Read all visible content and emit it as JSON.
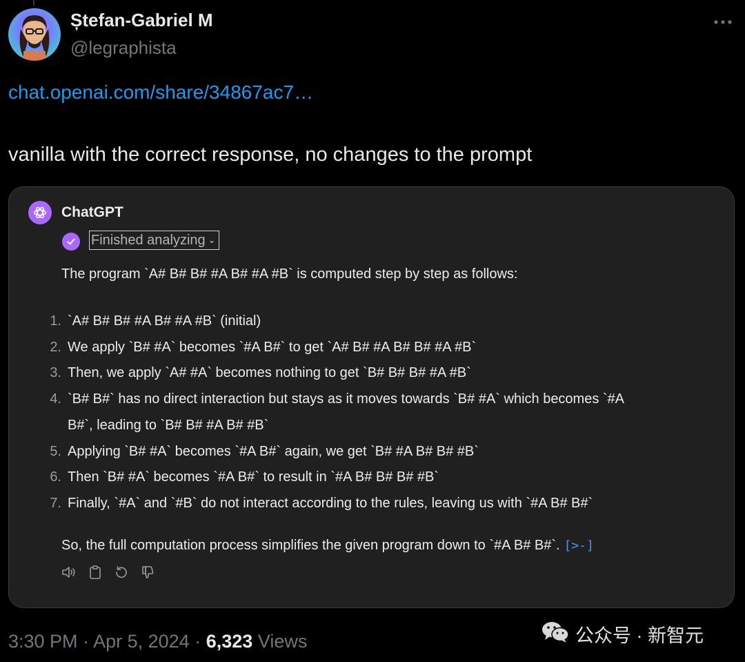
{
  "tweet": {
    "author_name": "Ștefan-Gabriel M",
    "author_handle": "@legraphista",
    "link_text": "chat.openai.com/share/34867ac7…",
    "text": "vanilla with the correct response, no changes to the prompt",
    "meta": {
      "time": "3:30 PM",
      "date": "Apr 5, 2024",
      "views_count": "6,323",
      "views_label": "Views"
    }
  },
  "chatgpt": {
    "name": "ChatGPT",
    "status": "Finished analyzing",
    "intro": "The program `A# B# B# #A B# #A #B` is computed step by step as follows:",
    "steps": [
      {
        "num": "1.",
        "text": "`A# B# B# #A B# #A #B` (initial)"
      },
      {
        "num": "2.",
        "text": "We apply `B# #A` becomes `#A B#` to get `A# B# #A B# B# #A #B`"
      },
      {
        "num": "3.",
        "text": "Then, we apply `A# #A` becomes nothing to get `B# B# B# #A #B`"
      },
      {
        "num": "4.",
        "text": "`B# B#` has no direct interaction but stays as it moves towards `B# #A` which becomes `#A",
        "text_cont": "B#`, leading to `B# B# #A B# #B`"
      },
      {
        "num": "5.",
        "text": "Applying `B# #A` becomes `#A B#` again, we get `B# #A B# B# #B`"
      },
      {
        "num": "6.",
        "text": "Then `B# #A` becomes `#A B#` to result in `#A B# B# B# #B`"
      },
      {
        "num": "7.",
        "text": "Finally, `#A` and `#B` do not interact according to the rules, leaving us with `#A B# B#`"
      }
    ],
    "conclusion": "So, the full computation process simplifies the given program down to `#A B# B#`.",
    "source_link": "[>-]",
    "actions": [
      "speaker-icon",
      "copy-icon",
      "regenerate-icon",
      "thumbs-down-icon"
    ]
  },
  "watermark": {
    "text": "公众号 · 新智元"
  },
  "colors": {
    "background": "#000000",
    "link": "#1d9bf0",
    "card": "#202020",
    "accent": "#ab68ff",
    "muted": "#71767b"
  }
}
